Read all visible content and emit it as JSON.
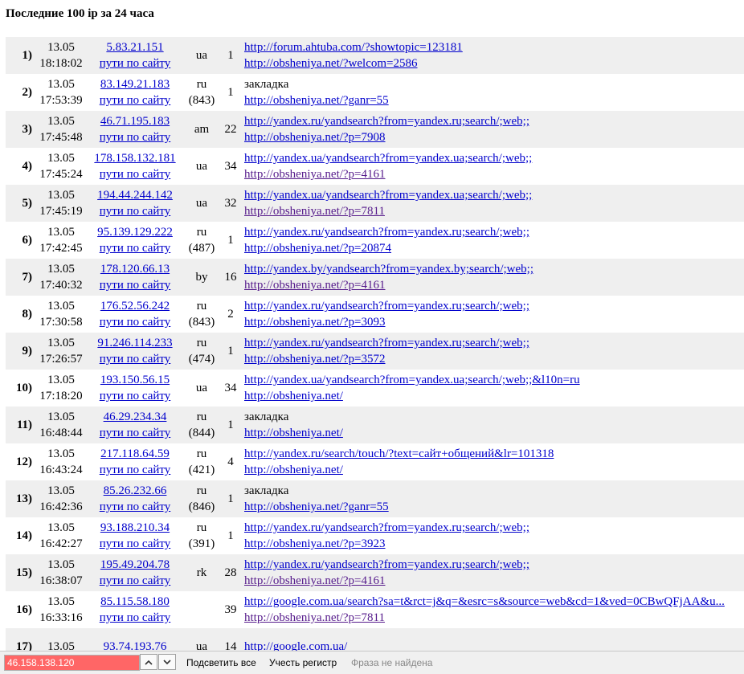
{
  "page": {
    "title": "Последние 100 ip за 24 часа"
  },
  "rows": [
    {
      "num": "1)",
      "date": "13.05",
      "time": "18:18:02",
      "ip": "5.83.21.151",
      "paths": "пути по сайту",
      "country": "ua",
      "sub": "",
      "hits": "1",
      "ref1": "http://forum.ahtuba.com/?showtopic=123181",
      "ref1_link": true,
      "ref1_visited": false,
      "ref2": "http://obsheniya.net/?welcom=2586",
      "ref2_visited": false
    },
    {
      "num": "2)",
      "date": "13.05",
      "time": "17:53:39",
      "ip": "83.149.21.183",
      "paths": "пути по сайту",
      "country": "ru",
      "sub": "(843)",
      "hits": "1",
      "ref1": "закладка",
      "ref1_link": false,
      "ref1_visited": false,
      "ref2": "http://obsheniya.net/?ganr=55",
      "ref2_visited": false
    },
    {
      "num": "3)",
      "date": "13.05",
      "time": "17:45:48",
      "ip": "46.71.195.183",
      "paths": "пути по сайту",
      "country": "am",
      "sub": "",
      "hits": "22",
      "ref1": "http://yandex.ru/yandsearch?from=yandex.ru;search/;web;;",
      "ref1_link": true,
      "ref1_visited": false,
      "ref2": "http://obsheniya.net/?p=7908",
      "ref2_visited": false
    },
    {
      "num": "4)",
      "date": "13.05",
      "time": "17:45:24",
      "ip": "178.158.132.181",
      "paths": "пути по сайту",
      "country": "ua",
      "sub": "",
      "hits": "34",
      "ref1": "http://yandex.ua/yandsearch?from=yandex.ua;search/;web;;",
      "ref1_link": true,
      "ref1_visited": false,
      "ref2": "http://obsheniya.net/?p=4161",
      "ref2_visited": true
    },
    {
      "num": "5)",
      "date": "13.05",
      "time": "17:45:19",
      "ip": "194.44.244.142",
      "paths": "пути по сайту",
      "country": "ua",
      "sub": "",
      "hits": "32",
      "ref1": "http://yandex.ua/yandsearch?from=yandex.ua;search/;web;;",
      "ref1_link": true,
      "ref1_visited": false,
      "ref2": "http://obsheniya.net/?p=7811",
      "ref2_visited": true
    },
    {
      "num": "6)",
      "date": "13.05",
      "time": "17:42:45",
      "ip": "95.139.129.222",
      "paths": "пути по сайту",
      "country": "ru",
      "sub": "(487)",
      "hits": "1",
      "ref1": "http://yandex.ru/yandsearch?from=yandex.ru;search/;web;;",
      "ref1_link": true,
      "ref1_visited": false,
      "ref2": "http://obsheniya.net/?p=20874",
      "ref2_visited": false
    },
    {
      "num": "7)",
      "date": "13.05",
      "time": "17:40:32",
      "ip": "178.120.66.13",
      "paths": "пути по сайту",
      "country": "by",
      "sub": "",
      "hits": "16",
      "ref1": "http://yandex.by/yandsearch?from=yandex.by;search/;web;;",
      "ref1_link": true,
      "ref1_visited": false,
      "ref2": "http://obsheniya.net/?p=4161",
      "ref2_visited": true
    },
    {
      "num": "8)",
      "date": "13.05",
      "time": "17:30:58",
      "ip": "176.52.56.242",
      "paths": "пути по сайту",
      "country": "ru",
      "sub": "(843)",
      "hits": "2",
      "ref1": "http://yandex.ru/yandsearch?from=yandex.ru;search/;web;;",
      "ref1_link": true,
      "ref1_visited": false,
      "ref2": "http://obsheniya.net/?p=3093",
      "ref2_visited": false
    },
    {
      "num": "9)",
      "date": "13.05",
      "time": "17:26:57",
      "ip": "91.246.114.233",
      "paths": "пути по сайту",
      "country": "ru",
      "sub": "(474)",
      "hits": "1",
      "ref1": "http://yandex.ru/yandsearch?from=yandex.ru;search/;web;;",
      "ref1_link": true,
      "ref1_visited": false,
      "ref2": "http://obsheniya.net/?p=3572",
      "ref2_visited": false
    },
    {
      "num": "10)",
      "date": "13.05",
      "time": "17:18:20",
      "ip": "193.150.56.15",
      "paths": "пути по сайту",
      "country": "ua",
      "sub": "",
      "hits": "34",
      "ref1": "http://yandex.ua/yandsearch?from=yandex.ua;search/;web;;&l10n=ru",
      "ref1_link": true,
      "ref1_visited": false,
      "ref2": "http://obsheniya.net/",
      "ref2_visited": false
    },
    {
      "num": "11)",
      "date": "13.05",
      "time": "16:48:44",
      "ip": "46.29.234.34",
      "paths": "пути по сайту",
      "country": "ru",
      "sub": "(844)",
      "hits": "1",
      "ref1": "закладка",
      "ref1_link": false,
      "ref1_visited": false,
      "ref2": "http://obsheniya.net/",
      "ref2_visited": false
    },
    {
      "num": "12)",
      "date": "13.05",
      "time": "16:43:24",
      "ip": "217.118.64.59",
      "paths": "пути по сайту",
      "country": "ru",
      "sub": "(421)",
      "hits": "4",
      "ref1": "http://yandex.ru/search/touch/?text=сайт+общений&lr=101318",
      "ref1_link": true,
      "ref1_visited": false,
      "ref2": "http://obsheniya.net/",
      "ref2_visited": false
    },
    {
      "num": "13)",
      "date": "13.05",
      "time": "16:42:36",
      "ip": "85.26.232.66",
      "paths": "пути по сайту",
      "country": "ru",
      "sub": "(846)",
      "hits": "1",
      "ref1": "закладка",
      "ref1_link": false,
      "ref1_visited": false,
      "ref2": "http://obsheniya.net/?ganr=55",
      "ref2_visited": false
    },
    {
      "num": "14)",
      "date": "13.05",
      "time": "16:42:27",
      "ip": "93.188.210.34",
      "paths": "пути по сайту",
      "country": "ru",
      "sub": "(391)",
      "hits": "1",
      "ref1": "http://yandex.ru/yandsearch?from=yandex.ru;search/;web;;",
      "ref1_link": true,
      "ref1_visited": false,
      "ref2": "http://obsheniya.net/?p=3923",
      "ref2_visited": false
    },
    {
      "num": "15)",
      "date": "13.05",
      "time": "16:38:07",
      "ip": "195.49.204.78",
      "paths": "пути по сайту",
      "country": "rk",
      "sub": "",
      "hits": "28",
      "ref1": "http://yandex.ru/yandsearch?from=yandex.ru;search/;web;;",
      "ref1_link": true,
      "ref1_visited": false,
      "ref2": "http://obsheniya.net/?p=4161",
      "ref2_visited": true
    },
    {
      "num": "16)",
      "date": "13.05",
      "time": "16:33:16",
      "ip": "85.115.58.180",
      "paths": "пути по сайту",
      "country": "",
      "sub": "",
      "hits": "39",
      "ref1": "http://google.com.ua/search?sa=t&rct=j&q=&esrc=s&source=web&cd=1&ved=0CBwQFjAA&u...",
      "ref1_link": true,
      "ref1_visited": false,
      "ref2": "http://obsheniya.net/?p=7811",
      "ref2_visited": true
    },
    {
      "num": "17)",
      "date": "13.05",
      "time": "",
      "ip": "93.74.193.76",
      "paths": "",
      "country": "ua",
      "sub": "",
      "hits": "14",
      "ref1": "http://google.com.ua/",
      "ref1_link": true,
      "ref1_visited": false,
      "ref2": "",
      "ref2_visited": false
    }
  ],
  "find_bar": {
    "query": "46.158.138.120",
    "prev_icon": "chevron-up-icon",
    "next_icon": "chevron-down-icon",
    "highlight_all": "Подсветить все",
    "match_case": "Учесть регистр",
    "status": "Фраза не найдена"
  }
}
